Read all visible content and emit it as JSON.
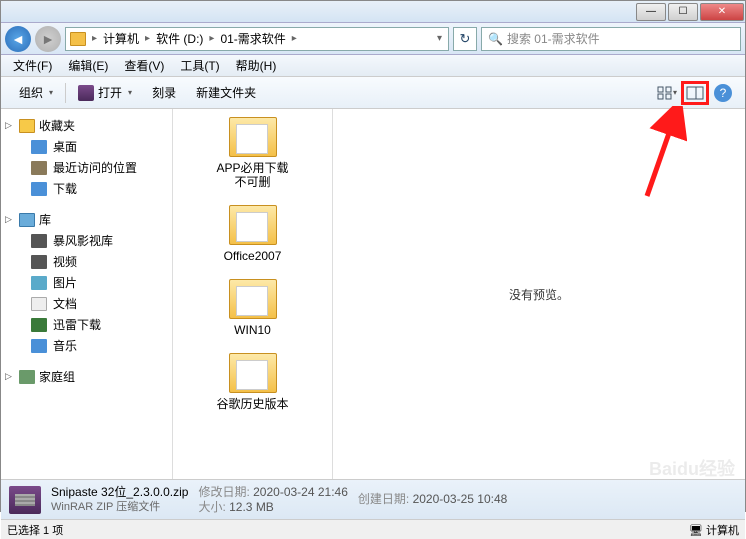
{
  "titlebar": {
    "min": "—",
    "max": "☐",
    "close": "✕"
  },
  "nav": {
    "breadcrumb": [
      "计算机",
      "软件 (D:)",
      "01-需求软件"
    ],
    "search_placeholder": "搜索 01-需求软件"
  },
  "menu": {
    "file": "文件(F)",
    "edit": "编辑(E)",
    "view": "查看(V)",
    "tools": "工具(T)",
    "help": "帮助(H)"
  },
  "toolbar": {
    "org": "组织",
    "open": "打开",
    "burn": "刻录",
    "newf": "新建文件夹"
  },
  "sidebar": {
    "favorites": {
      "label": "收藏夹",
      "items": [
        "桌面",
        "最近访问的位置",
        "下载"
      ]
    },
    "libraries": {
      "label": "库",
      "items": [
        "暴风影视库",
        "视频",
        "图片",
        "文档",
        "迅雷下载",
        "音乐"
      ]
    },
    "homegroup": {
      "label": "家庭组"
    }
  },
  "files": [
    {
      "label": "APP必用下载不可删"
    },
    {
      "label": "Office2007"
    },
    {
      "label": "WIN10"
    },
    {
      "label": "谷歌历史版本"
    }
  ],
  "preview": {
    "text": "没有预览。"
  },
  "details": {
    "name": "Snipaste 32位_2.3.0.0.zip",
    "type": "WinRAR ZIP 压缩文件",
    "mod_label": "修改日期:",
    "mod_val": "2020-03-24 21:46",
    "size_label": "大小:",
    "size_val": "12.3 MB",
    "create_label": "创建日期:",
    "create_val": "2020-03-25 10:48"
  },
  "status": {
    "sel": "已选择 1 项",
    "comp": "计算机"
  },
  "watermark": "Baidu经验"
}
